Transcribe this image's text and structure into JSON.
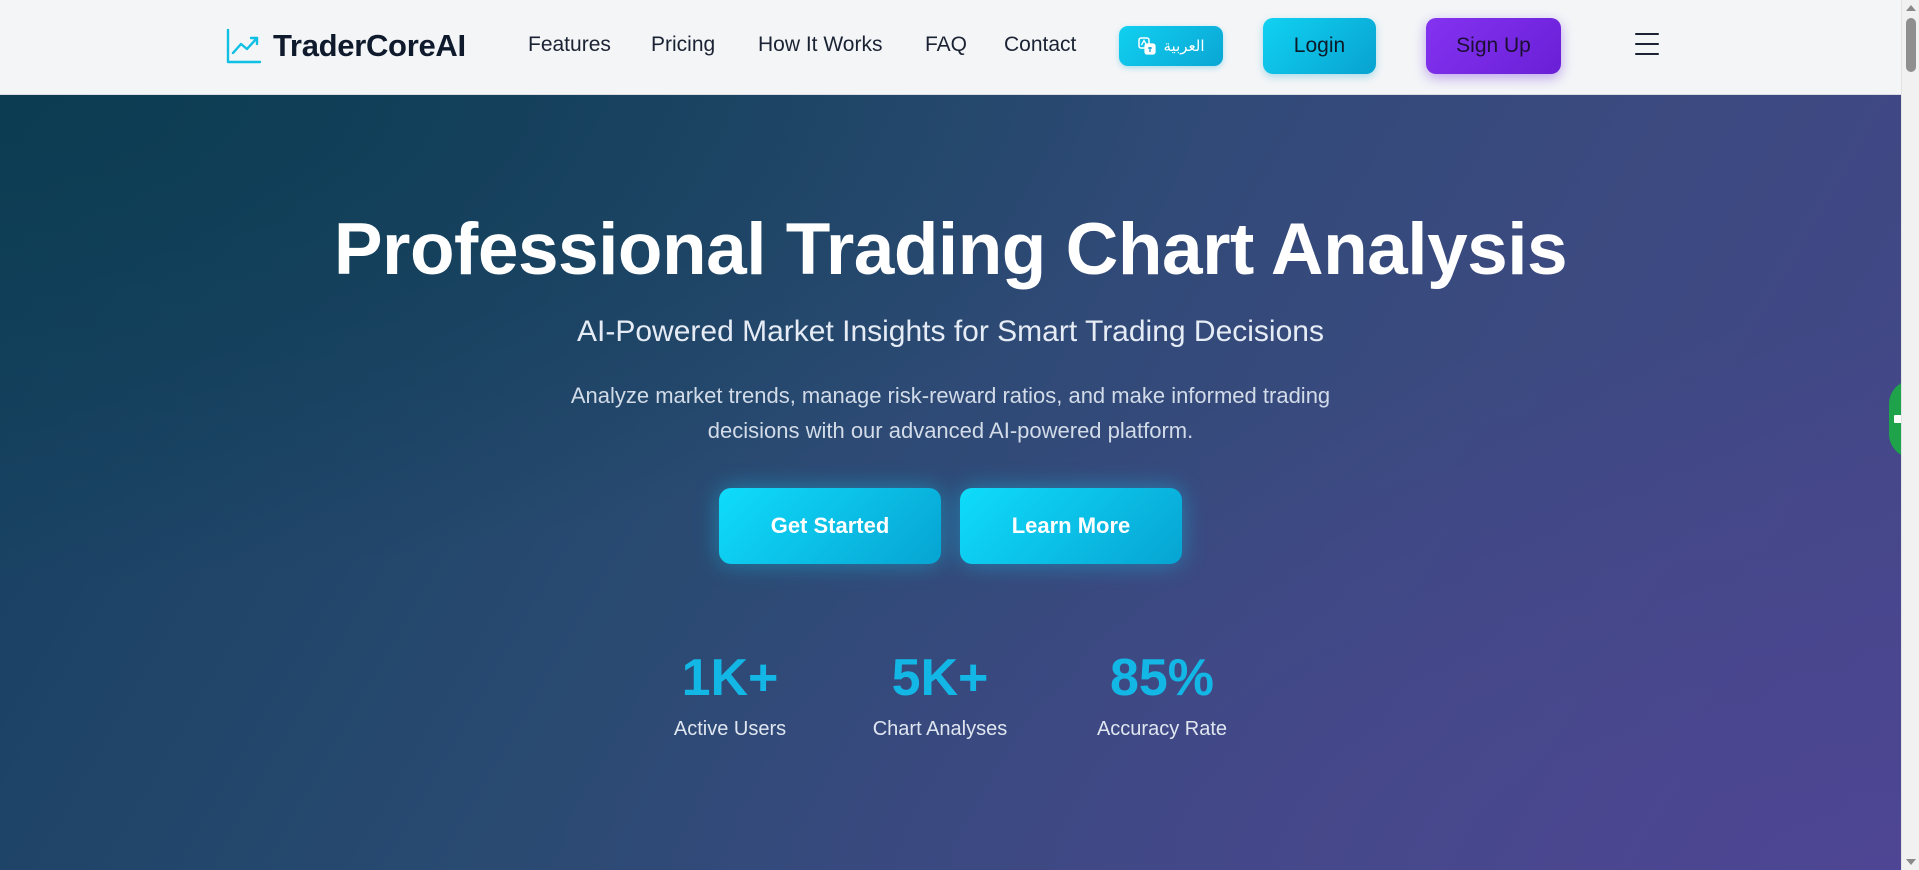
{
  "navbar": {
    "brand": "TraderCoreAI",
    "links": [
      "Features",
      "Pricing",
      "How It Works",
      "FAQ",
      "Contact"
    ],
    "language_label": "العربية",
    "login_label": "Login",
    "signup_label": "Sign Up"
  },
  "hero": {
    "title": "Professional Trading Chart Analysis",
    "subtitle": "AI-Powered Market Insights for Smart Trading Decisions",
    "description": "Analyze market trends, manage risk-reward ratios, and make informed trading decisions with our advanced AI-powered platform.",
    "cta_primary": "Get Started",
    "cta_secondary": "Learn More"
  },
  "stats": [
    {
      "value": "1K+",
      "label": "Active Users"
    },
    {
      "value": "5K+",
      "label": "Chart Analyses"
    },
    {
      "value": "85%",
      "label": "Accuracy Rate"
    }
  ],
  "colors": {
    "accent": "#0fc9ee",
    "signup": "#7a2ae8",
    "stat_value": "#13b7e6",
    "side_tab": "#1ea34a"
  }
}
